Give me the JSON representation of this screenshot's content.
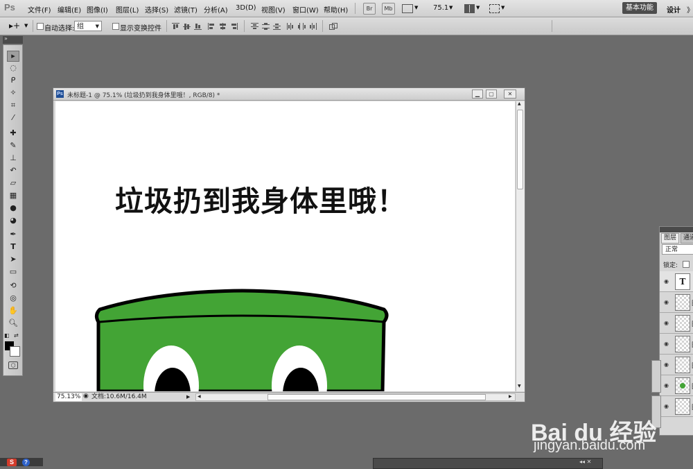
{
  "app": {
    "logo": "Ps",
    "colors": {
      "chrome": "#d4d4d4",
      "pasteboard": "#6b6b6b",
      "mascot_green": "#43a435",
      "workspace_active_bg": "#4d4d4d"
    }
  },
  "menu": {
    "items": [
      "文件(F)",
      "编辑(E)",
      "图像(I)",
      "图层(L)",
      "选择(S)",
      "滤镜(T)",
      "分析(A)",
      "3D(D)",
      "视图(V)",
      "窗口(W)",
      "帮助(H)"
    ],
    "bridge_label": "Br",
    "mini_bridge_label": "Mb",
    "zoom_level": "75.1",
    "workspace_basic": "基本功能",
    "workspace_design": "设计",
    "more": "》"
  },
  "options": {
    "auto_select_label": "自动选择:",
    "auto_select_value": "组",
    "show_transform_label": "显示变换控件"
  },
  "toolbox": {
    "tool_icons": [
      "move-icon",
      "marquee-icon",
      "lasso-icon",
      "quick-select-icon",
      "crop-icon",
      "eyedropper-icon",
      "healing-brush-icon",
      "brush-icon",
      "clone-stamp-icon",
      "history-brush-icon",
      "eraser-icon",
      "gradient-icon",
      "blur-icon",
      "dodge-icon",
      "pen-icon",
      "type-icon",
      "path-select-icon",
      "shape-icon",
      "3d-rotate-icon",
      "3d-orbit-icon",
      "hand-icon",
      "zoom-icon"
    ]
  },
  "document": {
    "title": "未标题-1 @ 75.1% (垃圾扔到我身体里哦！, RGB/8) *",
    "canvas_text": "垃圾扔到我身体里哦！",
    "zoom_readout": "75.13%",
    "doc_info": "文档:10.6M/16.4M"
  },
  "layers_panel": {
    "tab_layers": "图层",
    "tab_channels": "通道",
    "blend_mode": "正常",
    "lock_label": "锁定:",
    "rows": [
      {
        "thumb": "T",
        "label": "图"
      },
      {
        "thumb": "",
        "label": "图"
      },
      {
        "thumb": "",
        "label": "图"
      },
      {
        "thumb": "",
        "label": "图"
      },
      {
        "thumb": "",
        "label": "图"
      },
      {
        "thumb": "",
        "label": "图"
      },
      {
        "thumb": "",
        "label": "图"
      }
    ]
  },
  "taskbar": {
    "s_label": "S",
    "help_label": "?"
  },
  "watermark": {
    "logo": "Bai du 经验",
    "url": "jingyan.baidu.com"
  }
}
